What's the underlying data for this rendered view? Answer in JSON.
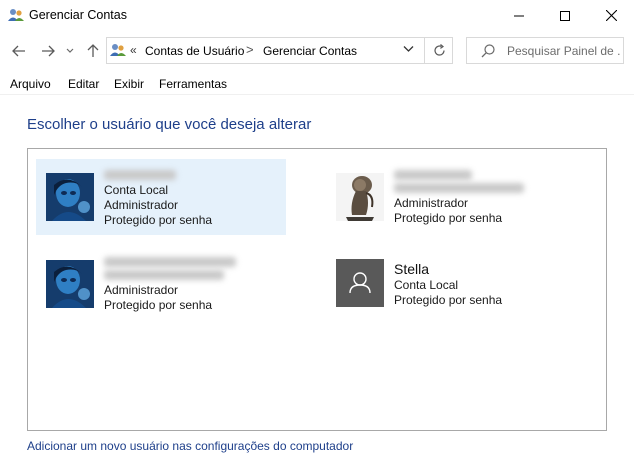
{
  "window": {
    "title": "Gerenciar Contas",
    "controls": [
      "minimize-icon",
      "maximize-icon",
      "close-icon"
    ]
  },
  "nav": {
    "icons": [
      "back-arrow-icon",
      "forward-arrow-icon",
      "recent-locations-chevron-icon",
      "up-arrow-icon"
    ]
  },
  "address": {
    "overflow": "«",
    "breadcrumbs": [
      "Contas de Usuário",
      "Gerenciar Contas"
    ],
    "separator": ">"
  },
  "search": {
    "placeholder": "Pesquisar Painel de ..."
  },
  "menu": [
    "Arquivo",
    "Editar",
    "Exibir",
    "Ferramentas"
  ],
  "heading": "Escolher o usuário que você deseja alterar",
  "accounts": [
    {
      "details": [
        "Conta Local",
        "Administrador",
        "Protegido por senha"
      ],
      "selected": true
    },
    {
      "details": [
        "Administrador",
        "Protegido por senha"
      ],
      "selected": false
    },
    {
      "details": [
        "Administrador",
        "Protegido por senha"
      ],
      "selected": false
    },
    {
      "name": "Stella",
      "details": [
        "Conta Local",
        "Protegido por senha"
      ],
      "selected": false
    }
  ],
  "footer_link": "Adicionar um novo usuário nas configurações do computador",
  "colors": {
    "heading": "#1e3f8a",
    "selection": "#e5f1fb",
    "link": "#1e3f8a",
    "default_avatar_bg": "#595959"
  }
}
